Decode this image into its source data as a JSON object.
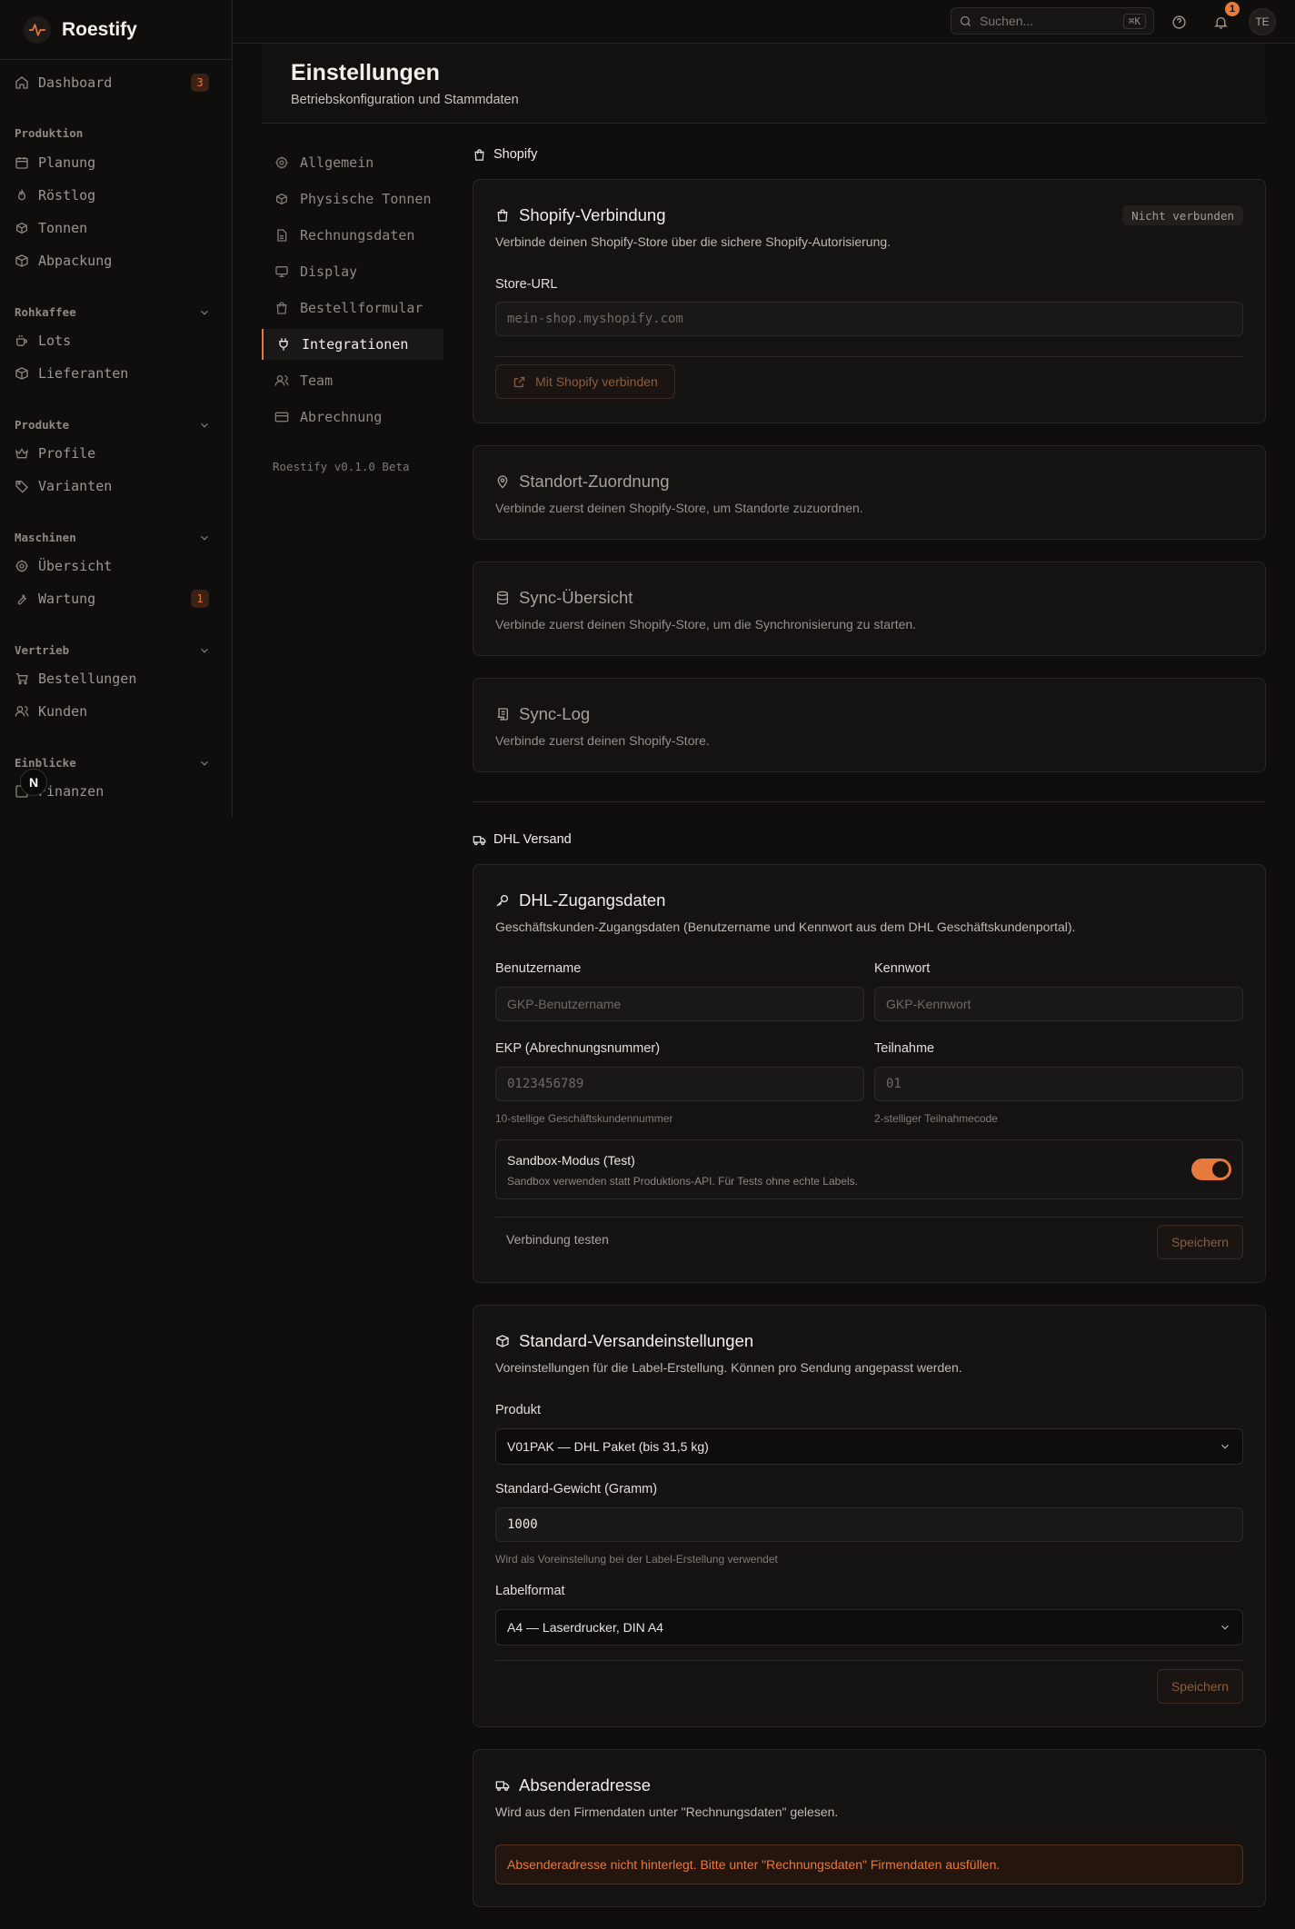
{
  "brand": {
    "name": "Roestify"
  },
  "sidebar": {
    "dashboard": {
      "label": "Dashboard",
      "badge": "3"
    },
    "groups": {
      "produktion": "Produktion",
      "rohkaffee": "Rohkaffee",
      "produkte": "Produkte",
      "maschinen": "Maschinen",
      "vertrieb": "Vertrieb",
      "einblicke": "Einblicke"
    },
    "items": {
      "planung": "Planung",
      "roestlog": "Röstlog",
      "tonnen": "Tonnen",
      "abpackung": "Abpackung",
      "lots": "Lots",
      "lieferanten": "Lieferanten",
      "profile": "Profile",
      "varianten": "Varianten",
      "uebersicht": "Übersicht",
      "wartung": "Wartung",
      "wartung_badge": "1",
      "bestellungen": "Bestellungen",
      "kunden": "Kunden",
      "finanzen": "Finanzen"
    },
    "next_badge": "N"
  },
  "topbar": {
    "search_placeholder": "Suchen...",
    "search_shortcut": "⌘K",
    "notification_count": "1",
    "avatar_initials": "TE"
  },
  "page": {
    "title": "Einstellungen",
    "subtitle": "Betriebskonfiguration und Stammdaten"
  },
  "settings_nav": {
    "items": [
      "Allgemein",
      "Physische Tonnen",
      "Rechnungsdaten",
      "Display",
      "Bestellformular",
      "Integrationen",
      "Team",
      "Abrechnung"
    ],
    "active": "Integrationen",
    "version": "Roestify v0.1.0 Beta"
  },
  "shopify": {
    "section_title": "Shopify",
    "connection": {
      "title": "Shopify-Verbindung",
      "status": "Nicht verbunden",
      "description": "Verbinde deinen Shopify-Store über die sichere Shopify-Autorisierung.",
      "store_url_label": "Store-URL",
      "store_url_placeholder": "mein-shop.myshopify.com",
      "connect_button": "Mit Shopify verbinden"
    },
    "location": {
      "title": "Standort-Zuordnung",
      "description": "Verbinde zuerst deinen Shopify-Store, um Standorte zuzuordnen."
    },
    "sync_overview": {
      "title": "Sync-Übersicht",
      "description": "Verbinde zuerst deinen Shopify-Store, um die Synchronisierung zu starten."
    },
    "sync_log": {
      "title": "Sync-Log",
      "description": "Verbinde zuerst deinen Shopify-Store."
    }
  },
  "dhl": {
    "section_title": "DHL Versand",
    "credentials": {
      "title": "DHL-Zugangsdaten",
      "description": "Geschäftskunden-Zugangsdaten (Benutzername und Kennwort aus dem DHL Geschäftskundenportal).",
      "username_label": "Benutzername",
      "username_placeholder": "GKP-Benutzername",
      "password_label": "Kennwort",
      "password_placeholder": "GKP-Kennwort",
      "ekp_label": "EKP (Abrechnungsnummer)",
      "ekp_placeholder": "0123456789",
      "ekp_hint": "10-stellige Geschäftskundennummer",
      "participation_label": "Teilnahme",
      "participation_placeholder": "01",
      "participation_hint": "2-stelliger Teilnahmecode",
      "sandbox_title": "Sandbox-Modus (Test)",
      "sandbox_description": "Sandbox verwenden statt Produktions-API. Für Tests ohne echte Labels.",
      "sandbox_enabled": true,
      "test_button": "Verbindung testen",
      "save_button": "Speichern"
    },
    "defaults": {
      "title": "Standard-Versandeinstellungen",
      "description": "Voreinstellungen für die Label-Erstellung. Können pro Sendung angepasst werden.",
      "product_label": "Produkt",
      "product_value": "V01PAK — DHL Paket (bis 31,5 kg)",
      "weight_label": "Standard-Gewicht (Gramm)",
      "weight_value": "1000",
      "weight_hint": "Wird als Voreinstellung bei der Label-Erstellung verwendet",
      "format_label": "Labelformat",
      "format_value": "A4 — Laserdrucker, DIN A4",
      "save_button": "Speichern"
    },
    "sender": {
      "title": "Absenderadresse",
      "description": "Wird aus den Firmendaten unter \"Rechnungsdaten\" gelesen.",
      "alert": "Absenderadresse nicht hinterlegt. Bitte unter \"Rechnungsdaten\" Firmendaten ausfüllen."
    }
  },
  "colors": {
    "accent": "#e8793c",
    "background": "#0f0e0d",
    "card": "#151312"
  }
}
